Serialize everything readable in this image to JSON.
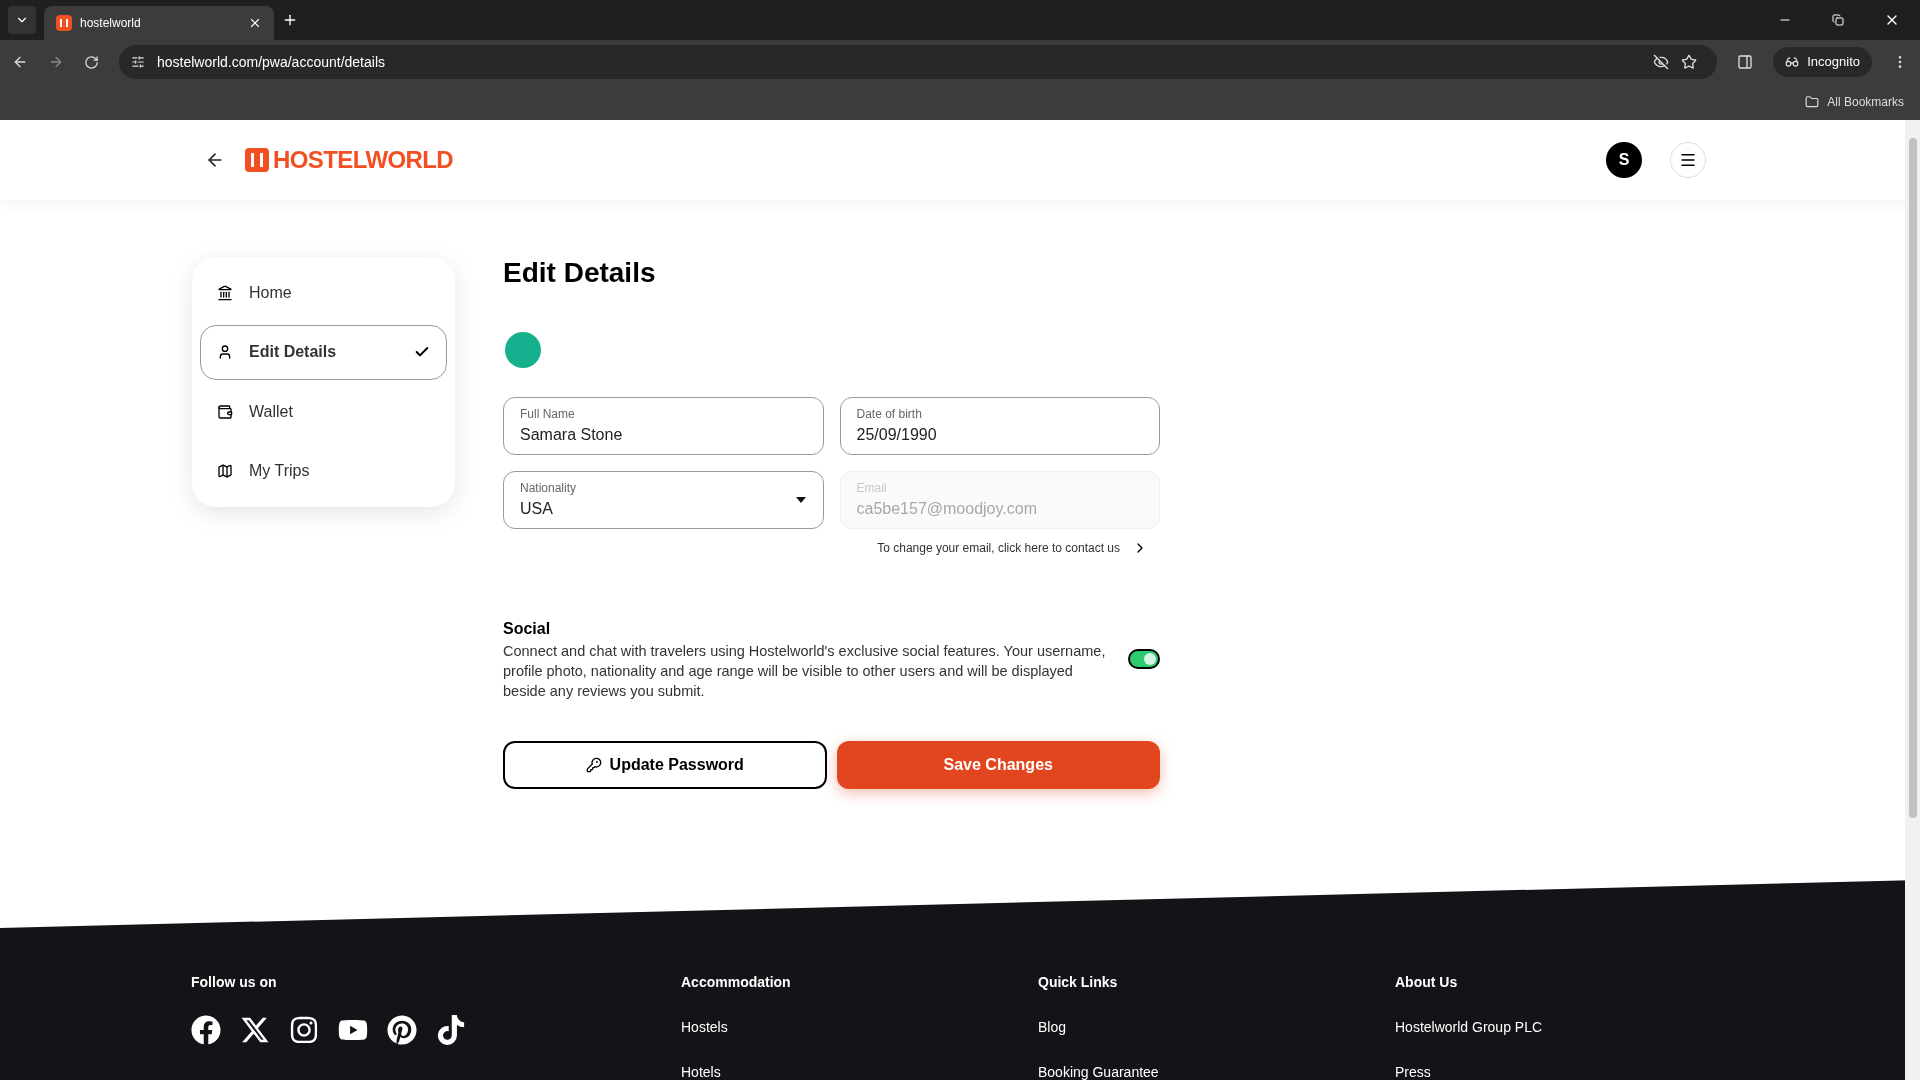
{
  "browser": {
    "tab_title": "hostelworld",
    "url": "hostelworld.com/pwa/account/details",
    "profile_label": "Incognito",
    "bookmarks_label": "All Bookmarks"
  },
  "header": {
    "logo_text": "HOSTELWORLD",
    "avatar_letter": "S"
  },
  "sidebar": {
    "items": [
      {
        "label": "Home",
        "kind": "home",
        "selected": false
      },
      {
        "label": "Edit Details",
        "kind": "user",
        "selected": true
      },
      {
        "label": "Wallet",
        "kind": "wallet",
        "selected": false
      },
      {
        "label": "My Trips",
        "kind": "map",
        "selected": false
      }
    ]
  },
  "title": "Edit Details",
  "fields": [
    {
      "label": "Full Name",
      "value": "Samara Stone",
      "kind": "text",
      "disabled": false
    },
    {
      "label": "Date of birth",
      "value": "25/09/1990",
      "kind": "text",
      "disabled": false
    },
    {
      "label": "Nationality",
      "value": "USA",
      "kind": "select",
      "disabled": false
    },
    {
      "label": "Email",
      "value": "ca5be157@moodjoy.com",
      "kind": "text",
      "disabled": true
    }
  ],
  "email_hint": "To change your email, click here to contact us",
  "social": {
    "title": "Social",
    "description": "Connect and chat with travelers using Hostelworld's exclusive social features. Your username, profile photo, nationality and age range will be visible to other users and will be displayed beside any reviews you submit.",
    "on": true
  },
  "buttons": {
    "secondary": "Update Password",
    "primary": "Save Changes"
  },
  "footer": {
    "follow_title": "Follow us on",
    "columns": [
      {
        "title": "Accommodation",
        "links": [
          "Hostels",
          "Hotels"
        ]
      },
      {
        "title": "Quick Links",
        "links": [
          "Blog",
          "Booking Guarantee"
        ]
      },
      {
        "title": "About Us",
        "links": [
          "Hostelworld Group PLC",
          "Press"
        ]
      }
    ]
  }
}
